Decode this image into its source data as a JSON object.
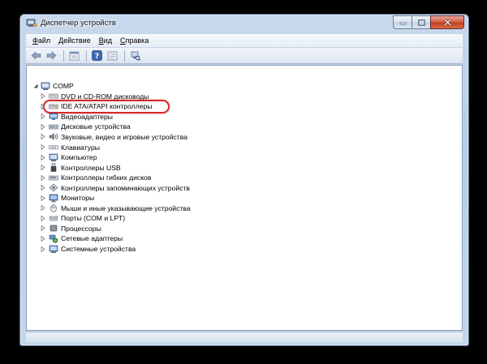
{
  "window": {
    "title": "Диспетчер устройств"
  },
  "menu": [
    {
      "label": "Файл",
      "underline": "Ф",
      "rest": "айл"
    },
    {
      "label": "Действие",
      "underline": "Д",
      "rest": "ействие"
    },
    {
      "label": "Вид",
      "underline": "В",
      "rest": "ид"
    },
    {
      "label": "Справка",
      "underline": "С",
      "rest": "правка"
    }
  ],
  "toolbar": {
    "buttons": [
      "back-icon",
      "forward-icon",
      "properties-icon",
      "help-icon",
      "update-icon",
      "scan-hardware-icon"
    ]
  },
  "tree": {
    "root": "COMP",
    "items": [
      {
        "label": "DVD и CD-ROM дисководы",
        "icon": "dvd-drive-icon"
      },
      {
        "label": "IDE ATA/ATAPI контроллеры",
        "icon": "ide-controller-icon"
      },
      {
        "label": "Видеоадаптеры",
        "icon": "display-adapter-icon"
      },
      {
        "label": "Дисковые устройства",
        "icon": "disk-drive-icon"
      },
      {
        "label": "Звуковые, видео и игровые устройства",
        "icon": "sound-icon"
      },
      {
        "label": "Клавиатуры",
        "icon": "keyboard-icon"
      },
      {
        "label": "Компьютер",
        "icon": "computer-icon"
      },
      {
        "label": "Контроллеры USB",
        "icon": "usb-icon"
      },
      {
        "label": "Контроллеры гибких дисков",
        "icon": "floppy-controller-icon"
      },
      {
        "label": "Контроллеры запоминающих устройств",
        "icon": "storage-controller-icon"
      },
      {
        "label": "Мониторы",
        "icon": "monitor-icon"
      },
      {
        "label": "Мыши и иные указывающие устройства",
        "icon": "mouse-icon"
      },
      {
        "label": "Порты (COM и LPT)",
        "icon": "port-icon"
      },
      {
        "label": "Процессоры",
        "icon": "processor-icon"
      },
      {
        "label": "Сетевые адаптеры",
        "icon": "network-adapter-icon"
      },
      {
        "label": "Системные устройства",
        "icon": "system-device-icon"
      }
    ]
  },
  "colors": {
    "highlight": "#d42a2a",
    "accent": "#4a7ab8"
  }
}
